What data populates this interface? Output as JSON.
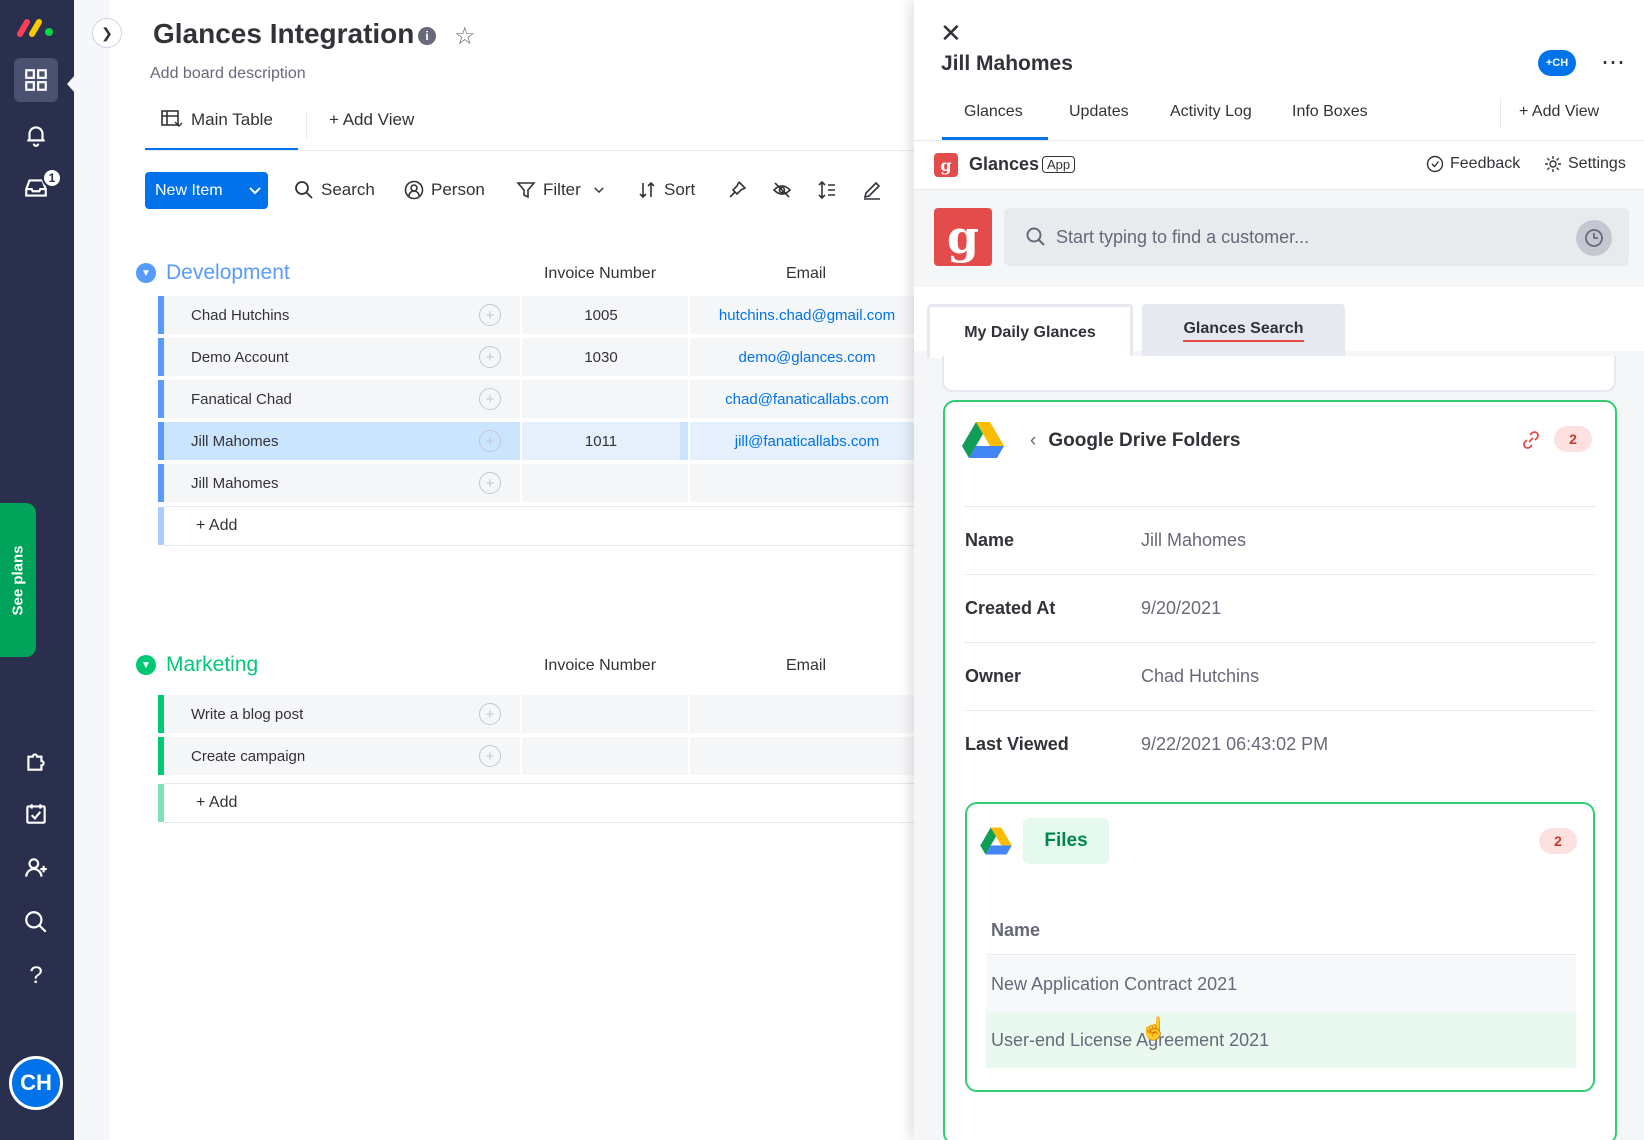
{
  "nav": {
    "notifications_badge": "1",
    "see_plans": "See plans",
    "avatar_initials": "CH"
  },
  "board": {
    "title": "Glances Integration",
    "description": "Add board description",
    "views": {
      "main": "Main Table",
      "add": "+ Add View"
    },
    "toolbar": {
      "new_item": "New Item",
      "search": "Search",
      "person": "Person",
      "filter": "Filter",
      "sort": "Sort"
    },
    "groups": [
      {
        "name": "Development",
        "color": "#579bfc",
        "columns": [
          "Invoice Number",
          "Email"
        ],
        "rows": [
          {
            "name": "Chad Hutchins",
            "invoice": "1005",
            "email": "hutchins.chad@gmail.com"
          },
          {
            "name": "Demo Account",
            "invoice": "1030",
            "email": "demo@glances.com"
          },
          {
            "name": "Fanatical Chad",
            "invoice": "",
            "email": "chad@fanaticallabs.com"
          },
          {
            "name": "Jill Mahomes",
            "invoice": "1011",
            "email": "jill@fanaticallabs.com"
          },
          {
            "name": "Jill Mahomes",
            "invoice": "",
            "email": ""
          }
        ],
        "add_label": "+ Add"
      },
      {
        "name": "Marketing",
        "color": "#00c875",
        "columns": [
          "Invoice Number",
          "Email"
        ],
        "rows": [
          {
            "name": "Write a blog post",
            "invoice": "",
            "email": ""
          },
          {
            "name": "Create campaign",
            "invoice": "",
            "email": ""
          }
        ],
        "add_label": "+ Add"
      }
    ]
  },
  "panel": {
    "title": "Jill Mahomes",
    "avatar": "CH",
    "tabs": [
      "Glances",
      "Updates",
      "Activity Log",
      "Info Boxes"
    ],
    "add_view": "+ Add View",
    "app": {
      "icon_letter": "g",
      "name": "Glances",
      "tag": "App",
      "feedback": "Feedback",
      "settings": "Settings"
    },
    "search_placeholder": "Start typing to find a customer...",
    "glance_tabs": [
      "My Daily Glances",
      "Glances Search"
    ],
    "card": {
      "title": "Google Drive Folders",
      "count": "2",
      "fields": [
        {
          "label": "Name",
          "value": "Jill Mahomes"
        },
        {
          "label": "Created At",
          "value": "9/20/2021"
        },
        {
          "label": "Owner",
          "value": "Chad Hutchins"
        },
        {
          "label": "Last Viewed",
          "value": "9/22/2021 06:43:02 PM"
        }
      ],
      "files": {
        "label": "Files",
        "count": "2",
        "column": "Name",
        "items": [
          "New Application Contract 2021",
          "User-end License Agreement 2021"
        ]
      }
    }
  },
  "colors": {
    "accent": "#0073ea",
    "nav_bg": "#292f4c",
    "glances_red": "#e44c4c",
    "green": "#33cc73"
  }
}
